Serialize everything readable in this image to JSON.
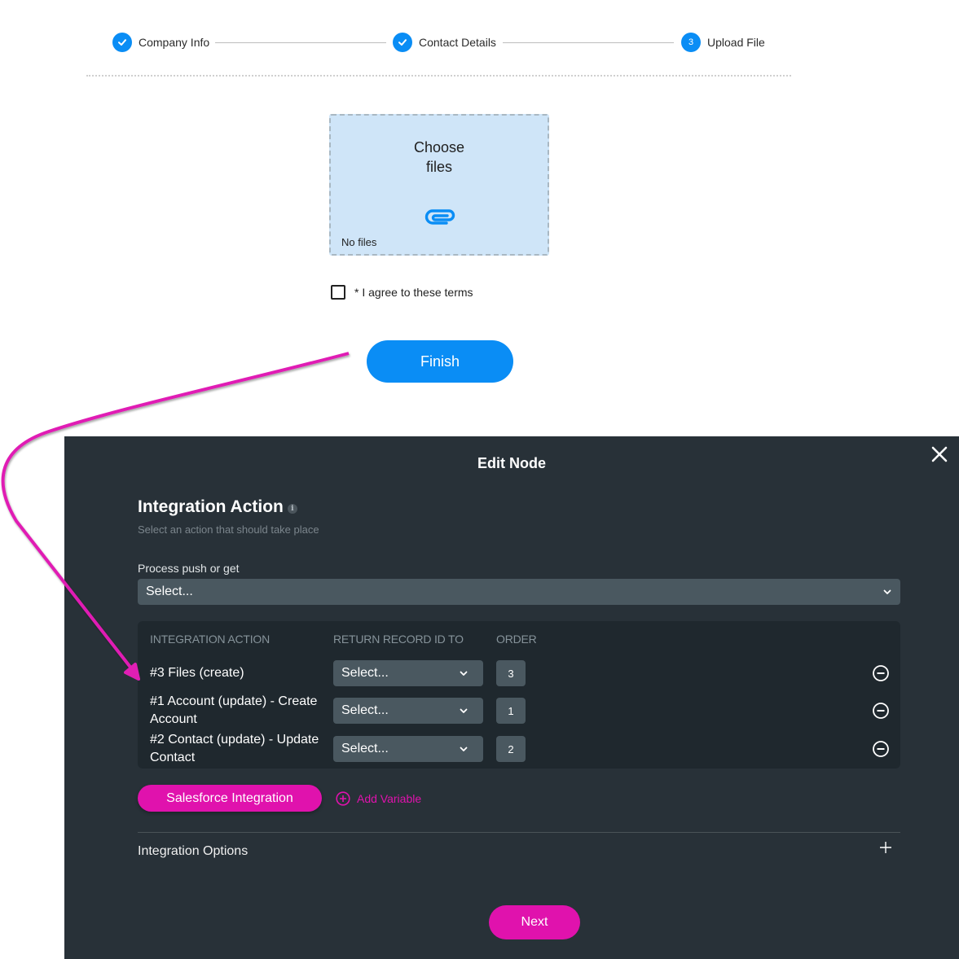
{
  "stepper": {
    "steps": [
      {
        "label": "Company Info",
        "status": "completed",
        "icon": "check-icon"
      },
      {
        "label": "Contact Details",
        "status": "completed",
        "icon": "check-icon"
      },
      {
        "label": "Upload File",
        "status": "current",
        "number": "3"
      }
    ]
  },
  "upload": {
    "title_line1": "Choose",
    "title_line2": "files",
    "icon": "paperclip-icon",
    "status": "No files"
  },
  "terms": {
    "label": "* I agree to these terms",
    "checked": false
  },
  "finish_button": "Finish",
  "annotation": {
    "arrow_color": "#e01fb4",
    "from": "finish-button",
    "to": "integration-row-files"
  },
  "modal": {
    "title": "Edit Node",
    "close_icon": "close-icon",
    "section_title": "Integration Action",
    "info_icon": "i",
    "section_subtitle": "Select an action that should take place",
    "process_label": "Process push or get",
    "process_select": "Select...",
    "table": {
      "headers": [
        "INTEGRATION ACTION",
        "RETURN RECORD ID TO",
        "ORDER"
      ],
      "rows": [
        {
          "action": "#3 Files (create)",
          "return_to": "Select...",
          "order": "3"
        },
        {
          "action": "#1 Account (update) - Create Account",
          "return_to": "Select...",
          "order": "1"
        },
        {
          "action": "#2 Contact (update) - Update Contact",
          "return_to": "Select...",
          "order": "2"
        }
      ]
    },
    "salesforce_button": "Salesforce Integration",
    "add_variable": "Add Variable",
    "options_label": "Integration Options",
    "next_button": "Next"
  },
  "colors": {
    "primary_blue": "#0a8df5",
    "accent_magenta": "#e012ad",
    "modal_bg": "#283138",
    "panel_bg": "#1f282e",
    "input_bg": "#4a5860"
  }
}
